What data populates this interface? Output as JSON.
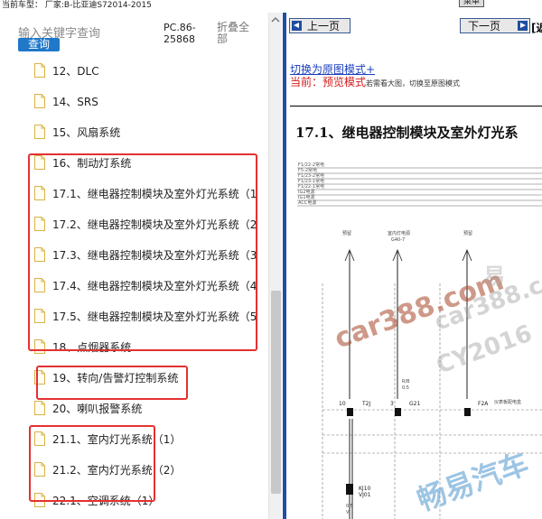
{
  "topbar": {
    "text": "当前车型：  厂家:B-比亚迪S72014-2015",
    "btn_label": "菜单"
  },
  "sidebar": {
    "search_placeholder": "输入关键字查询",
    "search_button": "查询",
    "pc_label": "PC.86-25868",
    "collapse_label": "折叠全部",
    "items": [
      {
        "label": "12、DLC"
      },
      {
        "label": "14、SRS"
      },
      {
        "label": "15、风扇系统"
      },
      {
        "label": "16、制动灯系统"
      },
      {
        "label": "17.1、继电器控制模块及室外灯光系统（1"
      },
      {
        "label": "17.2、继电器控制模块及室外灯光系统（2"
      },
      {
        "label": "17.3、继电器控制模块及室外灯光系统（3"
      },
      {
        "label": "17.4、继电器控制模块及室外灯光系统（4"
      },
      {
        "label": "17.5、继电器控制模块及室外灯光系统（5"
      },
      {
        "label": "18、点烟器系统"
      },
      {
        "label": "19、转向/告警灯控制系统"
      },
      {
        "label": "20、喇叭报警系统"
      },
      {
        "label": "21.1、室内灯光系统（1）"
      },
      {
        "label": "21.2、室内灯光系统（2）"
      },
      {
        "label": "22.1、空调系统（1）"
      }
    ]
  },
  "viewer": {
    "prev_button": "上一页",
    "next_button": "下一页",
    "nav_tail": "[返",
    "switch_link": "切换为原图模式+",
    "current_label": "当前：",
    "current_mode": "预览模式",
    "current_hint": "若需看大图，切换至原图模式",
    "section_title": "17.1、继电器控制模块及室外灯光系",
    "diagram": {
      "legend": [
        "F1/22-2常电",
        "F5-2常电",
        "F1/23-2常电",
        "F1/23-1常电",
        "F1/22-1常电",
        "IG2电源",
        "IG1电源",
        "ACC电源"
      ],
      "col_labels": [
        "预留",
        "室内灯电源",
        "预留"
      ],
      "connectors": [
        "10",
        "T2J",
        "3",
        "G21",
        "F2A",
        "KJ10",
        "VJ01"
      ],
      "small_labels": [
        "G40-7",
        "R/B",
        "0.5",
        "仪表板配电盒",
        "V",
        "0.5"
      ]
    },
    "watermarks": [
      "car388.com",
      "car388.co",
      "CY2016",
      "畅易汽车",
      "易"
    ]
  },
  "colors": {
    "highlight_box": "#e53030",
    "viewer_border": "#1f4fa0",
    "search_button_bg": "#1f78c8",
    "link": "#1a3fbf",
    "current_red": "#d21b1b"
  }
}
